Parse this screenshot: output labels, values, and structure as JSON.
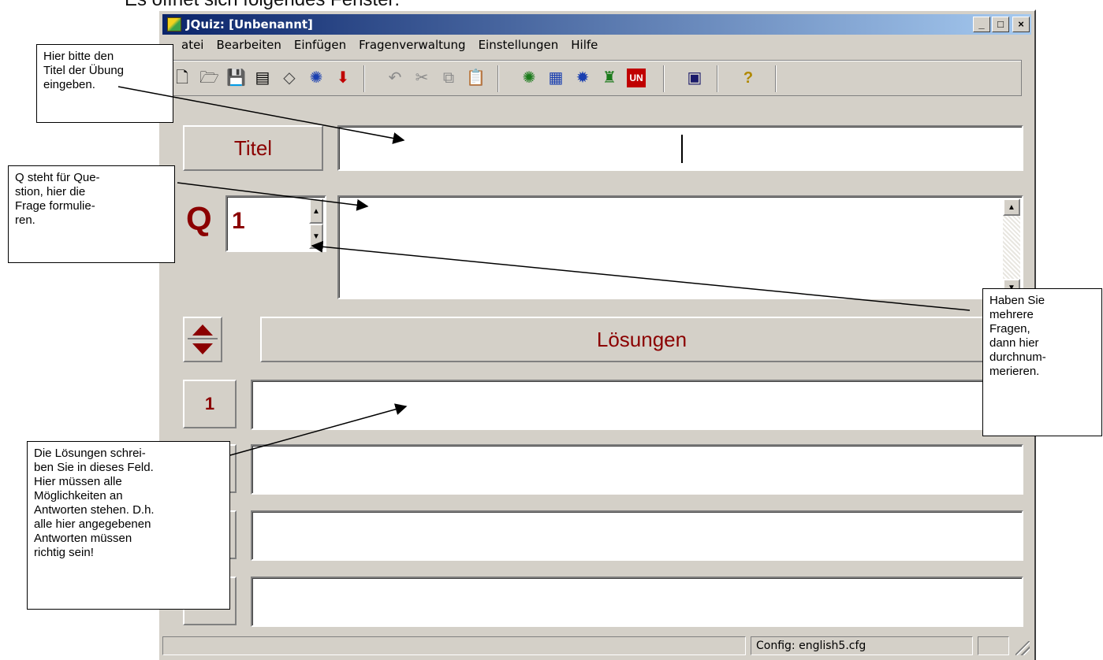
{
  "document": {
    "heading": "Es öffnet sich folgendes Fenster:"
  },
  "window": {
    "title": "JQuiz: [Unbenannt]",
    "controls": {
      "minimize": "_",
      "maximize": "□",
      "close": "×"
    }
  },
  "menu": [
    "atei",
    "Bearbeiten",
    "Einfügen",
    "Fragenverwaltung",
    "Einstellungen",
    "Hilfe"
  ],
  "toolbar": {
    "icons": [
      "new-file-icon",
      "open-folder-icon",
      "save-icon",
      "save-as-icon",
      "eraser-icon",
      "web-export-icon",
      "download-arrow-icon",
      "undo-icon",
      "cut-icon",
      "copy-icon",
      "paste-icon",
      "web-page-icon",
      "image-insert-icon",
      "web-export-2-icon",
      "hotpotatoes-icon",
      "unicode-icon",
      "graphics-icon",
      "help-icon"
    ]
  },
  "editor": {
    "titel_button": "Titel",
    "titel_value": "",
    "question_label": "Q",
    "question_number": "1",
    "question_text": "",
    "answers_header": "Lösungen",
    "answers": [
      {
        "number": "1",
        "value": ""
      },
      {
        "number": "",
        "value": ""
      },
      {
        "number": "",
        "value": ""
      },
      {
        "number": "",
        "value": ""
      }
    ]
  },
  "statusbar": {
    "config": "Config: english5.cfg"
  },
  "annotations": {
    "titel": [
      "Hier bitte den",
      "Titel der Übung",
      "eingeben."
    ],
    "question": [
      "Q steht für Que-",
      "stion, hier die",
      "Frage formulie-",
      "ren."
    ],
    "numbering": [
      "Haben Sie",
      "mehrere",
      "Fragen,",
      "dann hier",
      "durchnum-",
      "merieren."
    ],
    "answers": [
      "Die Lösungen schrei-",
      "ben Sie in dieses Feld.",
      "Hier müssen alle",
      "Möglichkeiten an",
      "Antworten stehen. D.h.",
      "alle hier angegebenen",
      "Antworten müssen",
      "richtig sein!"
    ]
  }
}
